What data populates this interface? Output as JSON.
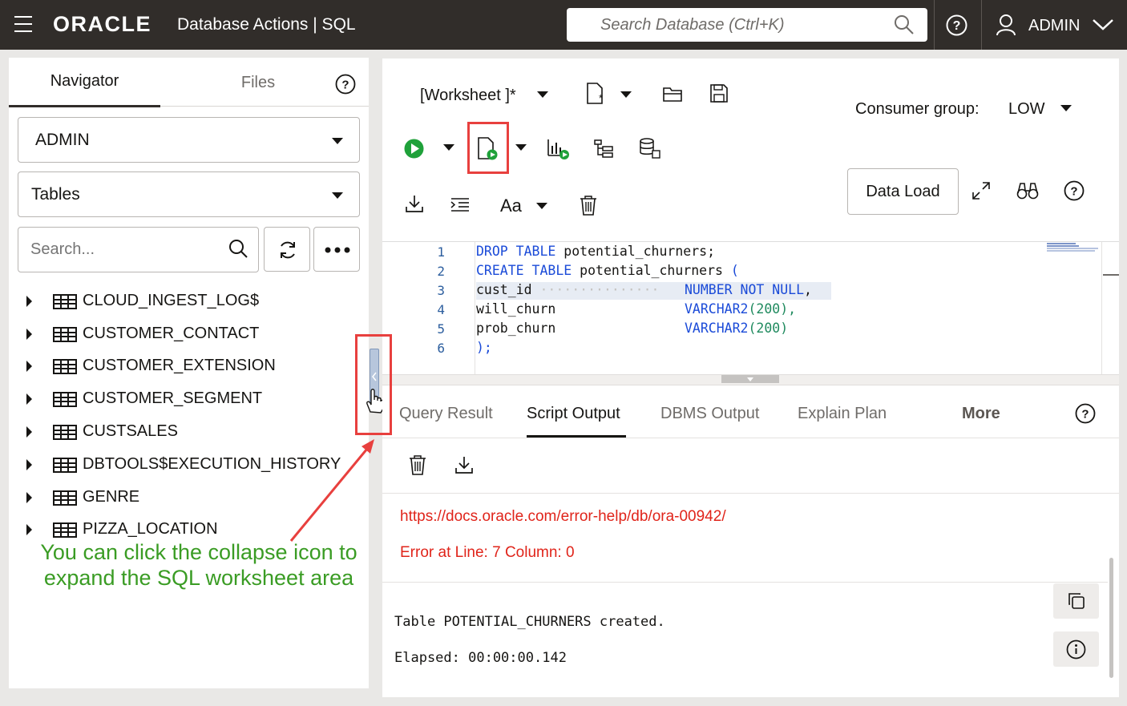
{
  "header": {
    "brand": "ORACLE",
    "app_title": "Database Actions |  SQL",
    "search_placeholder": "Search Database (Ctrl+K)",
    "user": "ADMIN"
  },
  "navigator": {
    "tabs": [
      "Navigator",
      "Files"
    ],
    "schema": "ADMIN",
    "object_type": "Tables",
    "search_placeholder": "Search...",
    "items": [
      "CLOUD_INGEST_LOG$",
      "CUSTOMER_CONTACT",
      "CUSTOMER_EXTENSION",
      "CUSTOMER_SEGMENT",
      "CUSTSALES",
      "DBTOOLS$EXECUTION_HISTORY",
      "GENRE",
      "PIZZA_LOCATION"
    ]
  },
  "worksheet": {
    "name": "[Worksheet ]*",
    "consumer_group_label": "Consumer group:",
    "consumer_group_value": "LOW",
    "data_load_label": "Data Load",
    "font_label": "Aa"
  },
  "editor": {
    "lines": [
      {
        "n": "1"
      },
      {
        "n": "2"
      },
      {
        "n": "3"
      },
      {
        "n": "4"
      },
      {
        "n": "5"
      },
      {
        "n": "6"
      }
    ],
    "code": {
      "l1_kw": "DROP TABLE",
      "l1_rest": " potential_churners;",
      "l2_kw": "CREATE TABLE",
      "l2_rest": " potential_churners ",
      "l2_paren": "(",
      "l3_col": "cust_id",
      "l3_dots": " ···············",
      "l3_type": "NUMBER NOT NULL",
      "l3_end": ",",
      "l4_col": "will_churn",
      "l4_type": "VARCHAR2",
      "l4_open": "(",
      "l4_num": "200",
      "l4_close": "),",
      "l5_col": "prob_churn",
      "l5_type": "VARCHAR2",
      "l5_open": "(",
      "l5_num": "200",
      "l5_close": ")",
      "l6": ");"
    }
  },
  "output": {
    "tabs": [
      "Query Result",
      "Script Output",
      "DBMS Output",
      "Explain Plan"
    ],
    "more_label": "More",
    "error_link": "https://docs.oracle.com/error-help/db/ora-00942/",
    "error_line": "Error at Line: 7 Column: 0",
    "created_msg": "Table POTENTIAL_CHURNERS created.",
    "elapsed_msg": "Elapsed: 00:00:00.142"
  },
  "annotation": {
    "callout_text": "You can click the collapse icon to expand the SQL worksheet area",
    "color": "#3a9c24",
    "highlight_color": "#e8403e"
  }
}
